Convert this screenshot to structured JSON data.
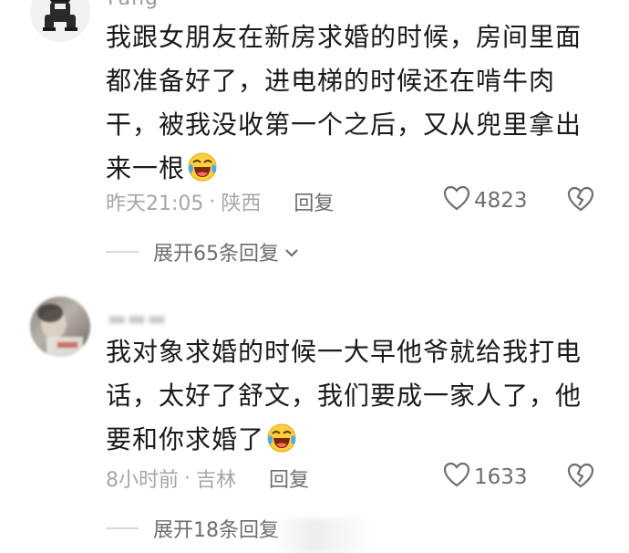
{
  "comments": [
    {
      "username": "Fang",
      "text": "我跟女朋友在新房求婚的时候，房间里面都准备好了，进电梯的时候还在啃牛肉干，被我没收第一个之后，又从兜里拿出来一根",
      "emoji_icon": "laughing-crying-emoji-icon",
      "time": "昨天21:05",
      "location": "陕西",
      "reply_label": "回复",
      "likes": "4823",
      "expand_label": "展开65条回复"
    },
    {
      "username": "",
      "text": "我对象求婚的时候一大早他爷就给我打电话，太好了舒文，我们要成一家人了，他要和你求婚了",
      "emoji_icon": "laughing-crying-emoji-icon",
      "time": "8小时前",
      "location": "吉林",
      "reply_label": "回复",
      "likes": "1633",
      "expand_label": "展开18条回复"
    }
  ],
  "colors": {
    "text": "#1a1a1a",
    "meta": "#a6a6a6",
    "action": "#6d6d6d"
  }
}
